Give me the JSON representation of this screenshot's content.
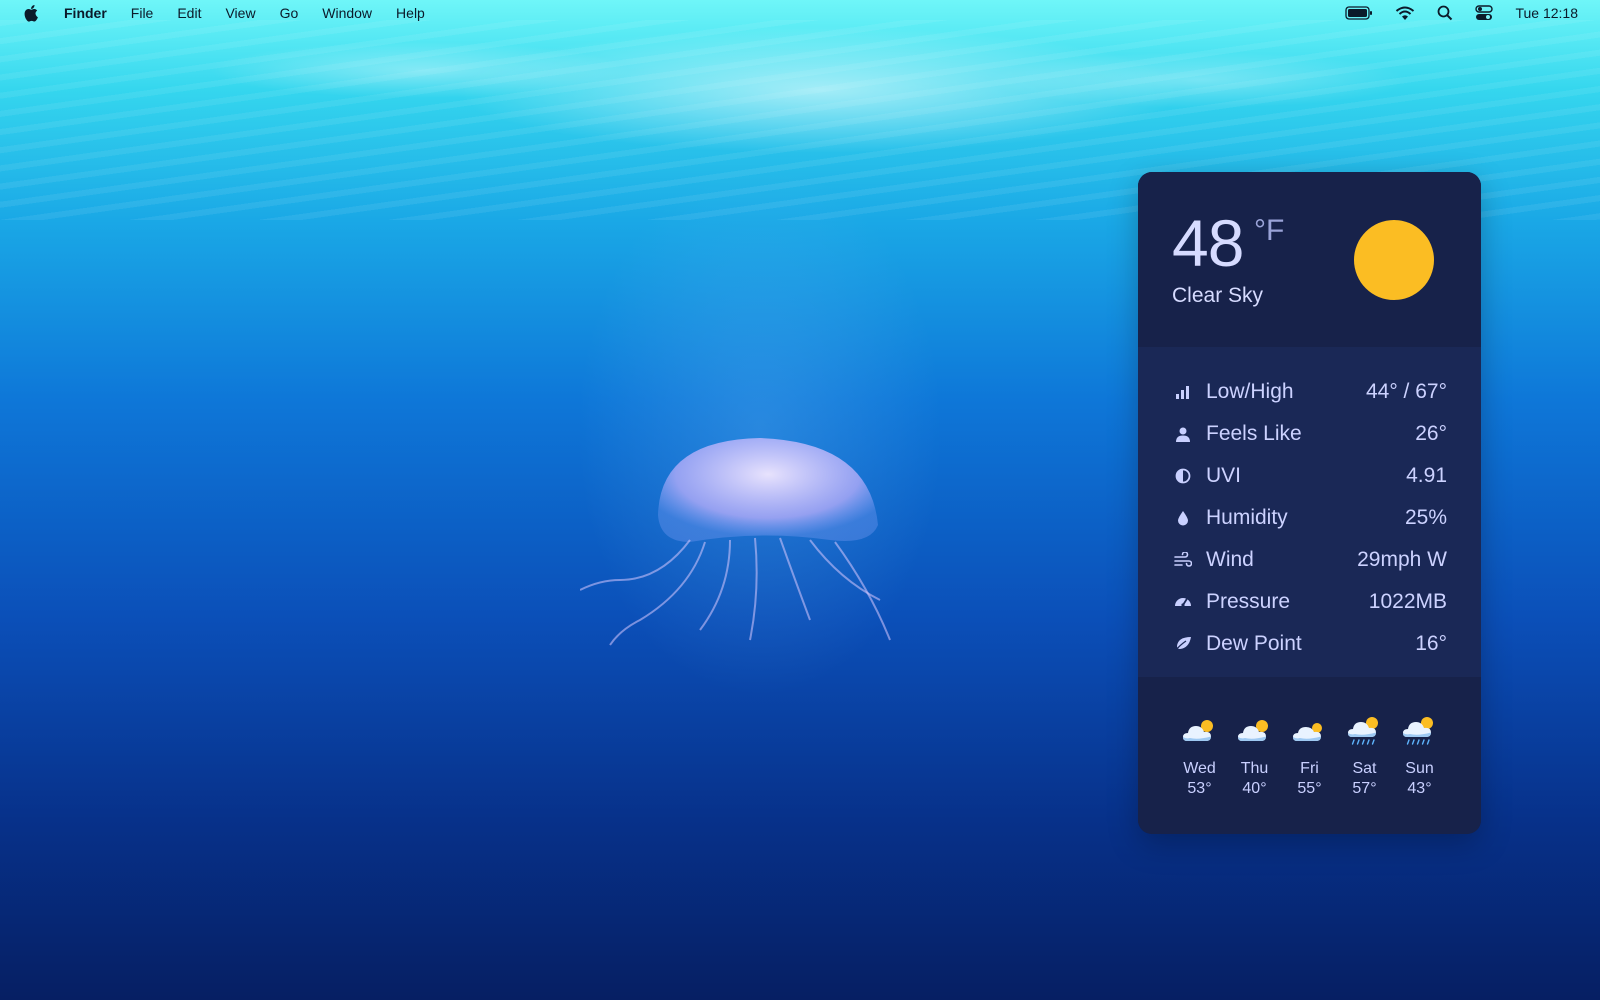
{
  "menubar": {
    "app_name": "Finder",
    "menus": [
      "File",
      "Edit",
      "View",
      "Go",
      "Window",
      "Help"
    ],
    "status_icons": [
      "battery-icon",
      "wifi-icon",
      "search-icon",
      "control-center-icon"
    ],
    "clock": "Tue 12:18"
  },
  "weather": {
    "temperature": "48",
    "unit": "°F",
    "condition": "Clear Sky",
    "details": [
      {
        "icon": "bar-chart-icon",
        "label": "Low/High",
        "value": "44° / 67°"
      },
      {
        "icon": "person-icon",
        "label": "Feels Like",
        "value": "26°"
      },
      {
        "icon": "half-circle-icon",
        "label": "UVI",
        "value": "4.91"
      },
      {
        "icon": "droplet-icon",
        "label": "Humidity",
        "value": "25%"
      },
      {
        "icon": "wind-icon",
        "label": "Wind",
        "value": "29mph W"
      },
      {
        "icon": "gauge-icon",
        "label": "Pressure",
        "value": "1022MB"
      },
      {
        "icon": "leaf-icon",
        "label": "Dew Point",
        "value": "16°"
      }
    ],
    "forecast": [
      {
        "day": "Wed",
        "temp": "53°",
        "icon": "partly-cloudy-icon"
      },
      {
        "day": "Thu",
        "temp": "40°",
        "icon": "partly-cloudy-icon"
      },
      {
        "day": "Fri",
        "temp": "55°",
        "icon": "partly-cloudy-icon"
      },
      {
        "day": "Sat",
        "temp": "57°",
        "icon": "rain-sun-icon"
      },
      {
        "day": "Sun",
        "temp": "43°",
        "icon": "rain-sun-icon"
      }
    ],
    "colors": {
      "sun": "#fbbd23",
      "panel": "#16214a",
      "text": "#c9d0ff"
    }
  }
}
